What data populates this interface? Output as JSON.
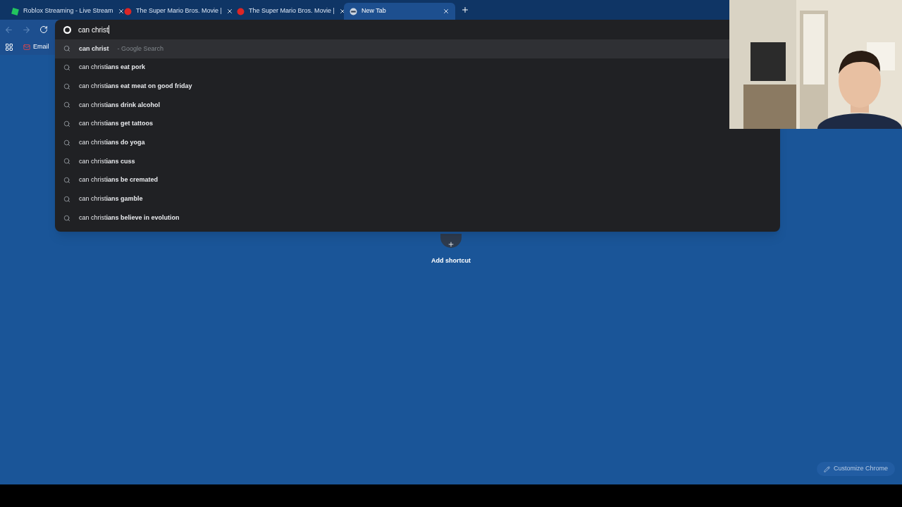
{
  "tabs": [
    {
      "kind": "roblox",
      "title": "Roblox Streaming - Live Stream",
      "selected": false
    },
    {
      "kind": "mario",
      "title": "The Super Mario Bros. Movie |",
      "selected": false
    },
    {
      "kind": "mario",
      "title": "The Super Mario Bros. Movie |",
      "selected": false
    },
    {
      "kind": "newtab",
      "title": "New Tab",
      "selected": true
    }
  ],
  "omnibox": {
    "value": "can christ"
  },
  "suggestions": [
    {
      "text": "**can christ**",
      "hint": "- Google Search",
      "selected": true
    },
    {
      "text": "can christ**ians eat pork**",
      "selected": false
    },
    {
      "text": "can christ**ians eat meat on good friday**",
      "selected": false
    },
    {
      "text": "can christ**ians drink alcohol**",
      "selected": false
    },
    {
      "text": "can christ**ians get tattoos**",
      "selected": false
    },
    {
      "text": "can christ**ians do yoga**",
      "selected": false
    },
    {
      "text": "can christ**ians cuss**",
      "selected": false
    },
    {
      "text": "can christ**ians be cremated**",
      "selected": false
    },
    {
      "text": "can christ**ians gamble**",
      "selected": false
    },
    {
      "text": "can christ**ians believe in evolution**",
      "selected": false
    }
  ],
  "bookmarks": [
    {
      "label": "Email"
    }
  ],
  "shortcut": {
    "label": "Add shortcut"
  },
  "customize_button": {
    "label": "Customize Chrome"
  }
}
